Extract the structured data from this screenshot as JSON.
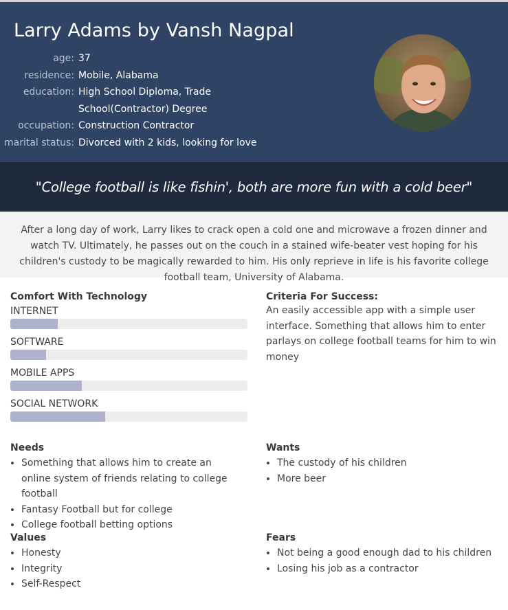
{
  "header": {
    "title": "Larry Adams by Vansh Nagpal",
    "fields": [
      {
        "label": "age:",
        "value": "37"
      },
      {
        "label": "residence:",
        "value": "Mobile, Alabama"
      },
      {
        "label": "education:",
        "value": "High School Diploma, Trade School(Contractor) Degree"
      },
      {
        "label": "occupation:",
        "value": "Construction Contractor"
      },
      {
        "label": "marital status:",
        "value": "Divorced with 2 kids, looking for love"
      }
    ]
  },
  "quote": "\"College football is like fishin', both are more fun with a cold beer\"",
  "bio": "After a long day of work, Larry likes to crack open a cold one and microwave a frozen dinner and watch TV. Ultimately, he passes out on the couch in a stained wife-beater vest hoping for his children's custody to be magically rewarded to him. His only reprieve in life is his favorite college football team, University of Alabama.",
  "technology": {
    "title": "Comfort With Technology",
    "items": [
      {
        "label": "INTERNET",
        "level": 0.2
      },
      {
        "label": "SOFTWARE",
        "level": 0.15
      },
      {
        "label": "MOBILE APPS",
        "level": 0.3
      },
      {
        "label": "SOCIAL NETWORK",
        "level": 0.4
      }
    ]
  },
  "criteria": {
    "title": "Criteria For Success:",
    "text": "An easily accessible app with a simple user interface. Something that allows him to enter parlays on college football teams for him to win money"
  },
  "needs": {
    "title": "Needs",
    "items": [
      "Something that allows him to create an online system of friends relating to college football",
      "Fantasy Football but for college",
      "College football betting options"
    ]
  },
  "wants": {
    "title": "Wants",
    "items": [
      "The custody of his children",
      "More beer"
    ]
  },
  "values": {
    "title": "Values",
    "items": [
      "Honesty",
      "Integrity",
      "Self-Respect"
    ]
  },
  "fears": {
    "title": "Fears",
    "items": [
      "Not being a good enough dad to his children",
      "Losing his job as a contractor"
    ]
  },
  "colors": {
    "header_bg": "#2f4364",
    "quote_bg": "#1f2a3d",
    "bar_fill": "#aeb1cb",
    "bar_track": "#ececec"
  }
}
